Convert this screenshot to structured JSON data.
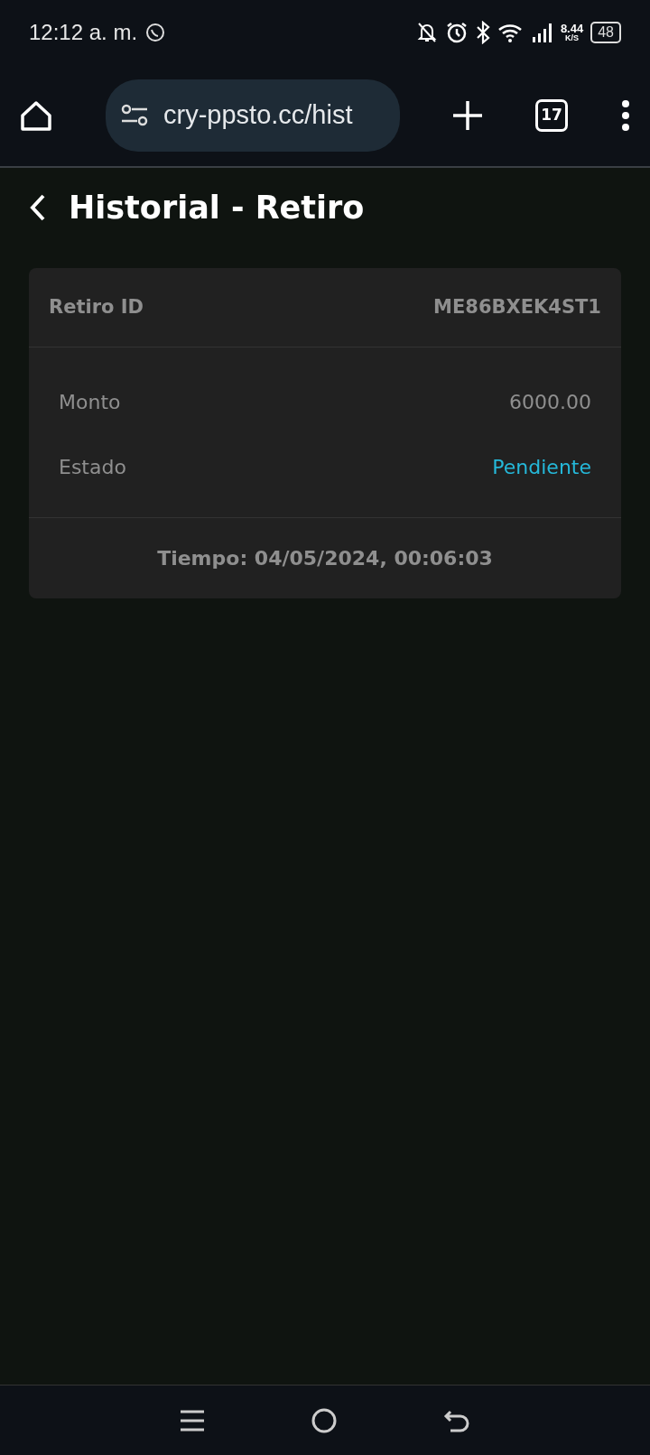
{
  "status_bar": {
    "time": "12:12 a. m.",
    "speed": "8.44",
    "speed_unit": "K/S",
    "battery": "48"
  },
  "browser": {
    "url": "cry-ppsto.cc/hist",
    "tab_count": "17"
  },
  "page": {
    "title": "Historial - Retiro"
  },
  "card": {
    "header_label": "Retiro ID",
    "header_value": "ME86BXEK4ST1",
    "rows": [
      {
        "label": "Monto",
        "value": "6000.00",
        "kind": "amount"
      },
      {
        "label": "Estado",
        "value": "Pendiente",
        "kind": "status"
      }
    ],
    "footer": "Tiempo: 04/05/2024, 00:06:03"
  }
}
